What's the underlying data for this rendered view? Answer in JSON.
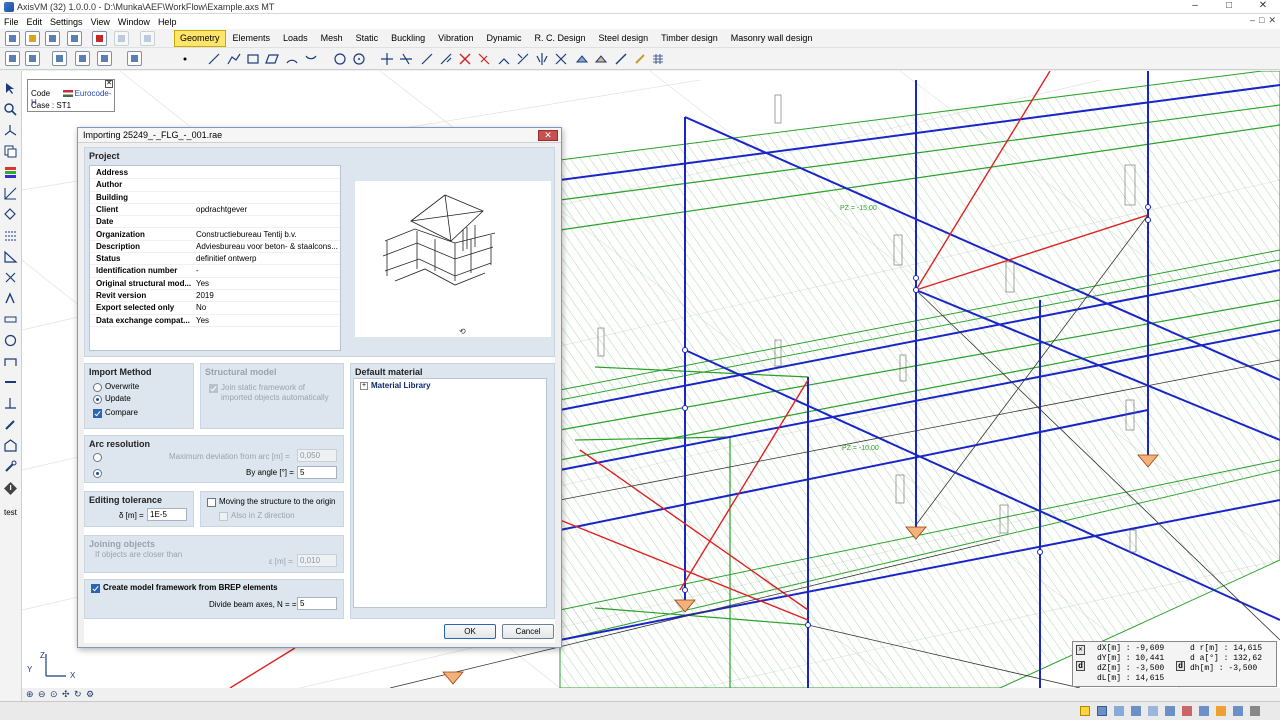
{
  "window": {
    "title": "AxisVM (32) 1.0.0.0 - D:\\Munka\\AEF\\WorkFlow\\Example.axs MT",
    "controls": [
      "–",
      "□",
      "✕"
    ]
  },
  "menu": {
    "items": [
      "File",
      "Edit",
      "Settings",
      "View",
      "Window",
      "Help"
    ],
    "mdi_controls": [
      "–",
      "□",
      "✕"
    ]
  },
  "tabs": [
    "Geometry",
    "Elements",
    "Loads",
    "Mesh",
    "Static",
    "Buckling",
    "Vibration",
    "Dynamic",
    "R. C. Design",
    "Steel design",
    "Timber design",
    "Masonry wall design"
  ],
  "active_tab": "Geometry",
  "code_panel": {
    "code_label": "Code",
    "code_value": "Eurocode-H",
    "case_label": "Case :",
    "case_value": "ST1",
    "close": "✕"
  },
  "left_toolbar": {
    "test_label": "test"
  },
  "dialog": {
    "title": "Importing 25249_-_FLG_-_001.rae",
    "close": "✕",
    "project": {
      "title": "Project",
      "rows": [
        {
          "key": "Address",
          "value": ""
        },
        {
          "key": "Author",
          "value": ""
        },
        {
          "key": "Building",
          "value": ""
        },
        {
          "key": "Client",
          "value": "opdrachtgever"
        },
        {
          "key": "Date",
          "value": ""
        },
        {
          "key": "Organization",
          "value": "Constructiebureau Tentij b.v."
        },
        {
          "key": "Description",
          "value": "Adviesbureau voor beton- & staalcons..."
        },
        {
          "key": "Status",
          "value": "definitief ontwerp"
        },
        {
          "key": "Identification number",
          "value": "-"
        },
        {
          "key": "Original structural mod...",
          "value": "Yes"
        },
        {
          "key": "Revit version",
          "value": "2019"
        },
        {
          "key": "Export selected only",
          "value": "No"
        },
        {
          "key": "Data exchange compat...",
          "value": "Yes"
        }
      ]
    },
    "import_method": {
      "title": "Import Method",
      "overwrite": "Overwrite",
      "update": "Update",
      "compare": "Compare"
    },
    "structural_model": {
      "title": "Structural model",
      "join_line1": "Join static framework of",
      "join_line2": "imported objects automatically"
    },
    "default_material": {
      "title": "Default material",
      "tree_item": "Material Library",
      "expander": "+"
    },
    "arc_resolution": {
      "title": "Arc resolution",
      "max_dev_label": "Maximum deviation from arc [m] =",
      "max_dev_value": "0,050",
      "by_angle_label": "By angle [°] =",
      "by_angle_value": "5"
    },
    "editing_tolerance": {
      "title": "Editing tolerance",
      "delta_label": "δ [m] =",
      "delta_value": "1E-5",
      "move_label": "Moving the structure to the origin",
      "also_z_label": "Also in Z direction"
    },
    "joining_objects": {
      "title": "Joining objects",
      "hint": "If objects are closer than",
      "eps_label": "ε [m] =",
      "eps_value": "0,010"
    },
    "brep": {
      "label": "Create model framework from BREP elements",
      "divide_label": "Divide beam axes, N = =",
      "divide_value": "5"
    },
    "ok": "OK",
    "cancel": "Cancel"
  },
  "viewport": {
    "level_labels": [
      "PZ = -15,00",
      "PZ = -10,00"
    ],
    "axis_labels": {
      "y": "Y",
      "z": "Z",
      "x": "X"
    }
  },
  "coords": {
    "d_marker": "d",
    "dX": "dX[m] : -9,609",
    "dY": "dY[m] : 10,441",
    "dZ": "dZ[m] : -3,500",
    "dL": "dL[m] : 14,615",
    "dr": "d r[m] : 14,615",
    "da": "d a[°] : 132,62",
    "dh": "dh[m] : -3,500"
  },
  "colors": {
    "active_tab": "#ffe66a",
    "blue_member": "#1a25c8",
    "green_member": "#2aa02a",
    "red_member": "#e02020",
    "hatch": "#b9e0b9"
  }
}
